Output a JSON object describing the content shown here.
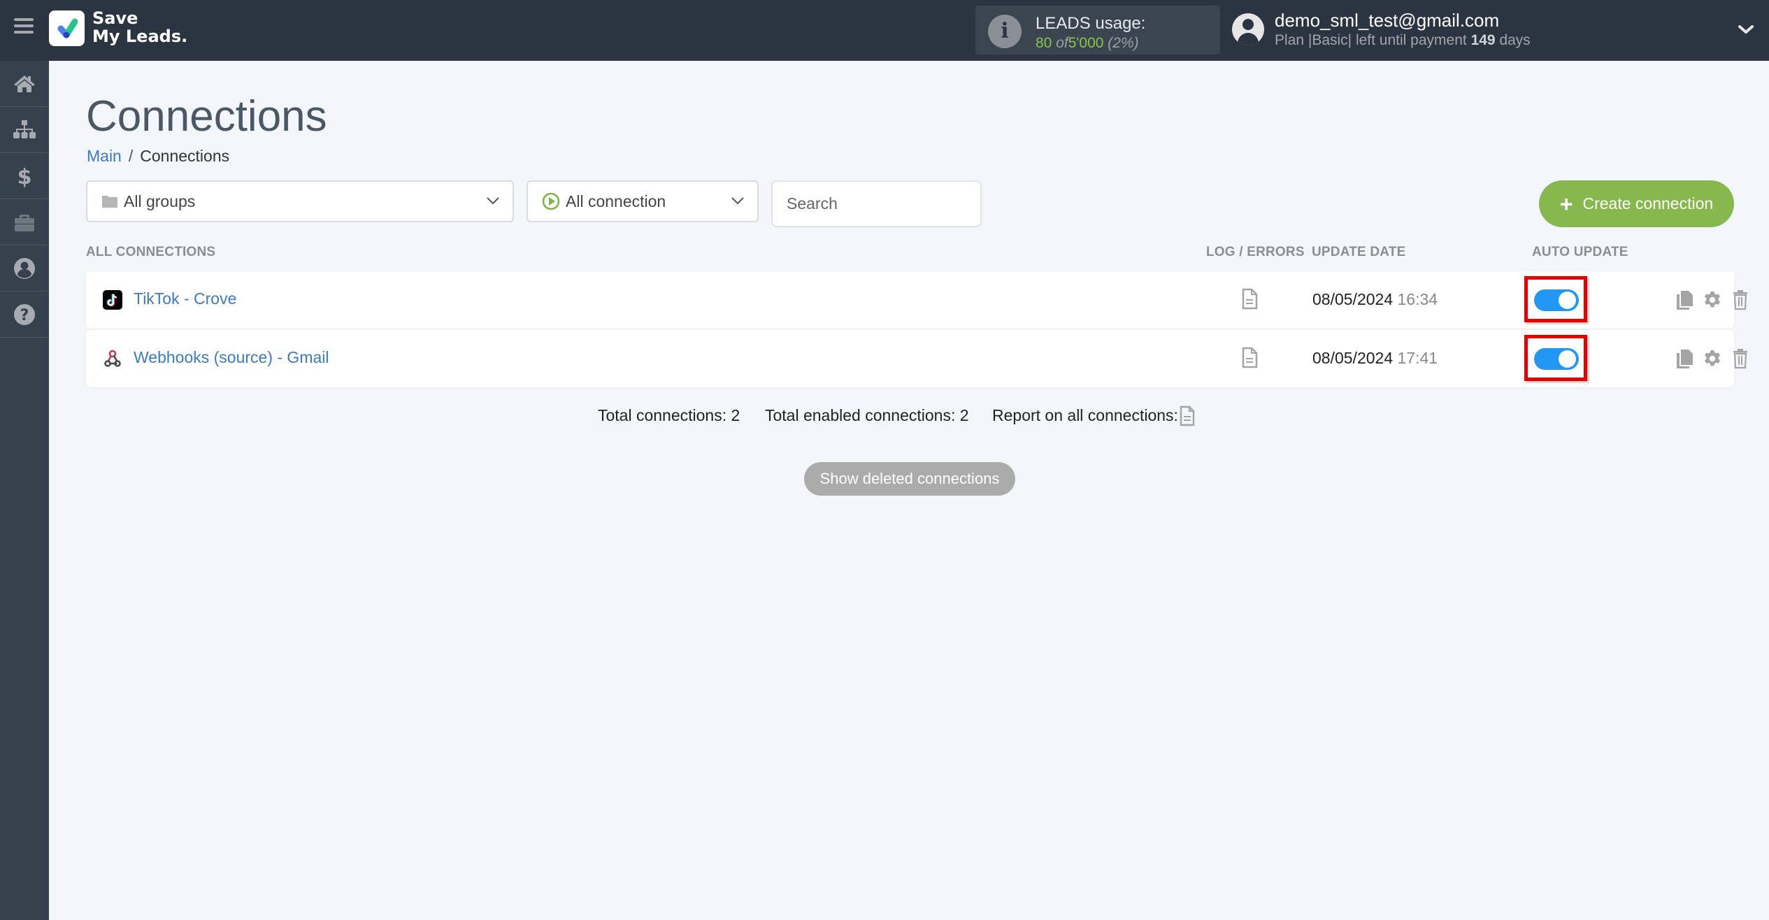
{
  "header": {
    "logo_line1": "Save",
    "logo_line2": "My Leads.",
    "usage_title": "LEADS usage:",
    "usage_used": "80",
    "usage_of": "of",
    "usage_total": "5'000",
    "usage_percent": "(2%)",
    "user_email": "demo_sml_test@gmail.com",
    "plan_prefix": "Plan |Basic| left until payment",
    "plan_days": "149",
    "plan_suffix": "days"
  },
  "sidebar": {
    "items": [
      {
        "name": "home",
        "icon": "home-icon"
      },
      {
        "name": "connections",
        "icon": "sitemap-icon"
      },
      {
        "name": "billing",
        "icon": "dollar-icon"
      },
      {
        "name": "tools",
        "icon": "briefcase-icon"
      },
      {
        "name": "account",
        "icon": "user-circle-icon"
      },
      {
        "name": "help",
        "icon": "question-circle-icon"
      }
    ]
  },
  "page": {
    "title": "Connections",
    "breadcrumb": {
      "home": "Main",
      "separator": "/",
      "current": "Connections"
    }
  },
  "filters": {
    "groups_value": "All groups",
    "connection_value": "All connection",
    "search_placeholder": "Search",
    "create_label": "Create connection"
  },
  "table": {
    "headers": {
      "all": "ALL CONNECTIONS",
      "log": "LOG / ERRORS",
      "date": "UPDATE DATE",
      "auto": "AUTO UPDATE"
    },
    "rows": [
      {
        "name": "TikTok - Crove",
        "service": "tiktok",
        "date": "08/05/2024",
        "time": "16:34",
        "auto_update": true
      },
      {
        "name": "Webhooks (source) - Gmail",
        "service": "webhooks",
        "date": "08/05/2024",
        "time": "17:41",
        "auto_update": true
      }
    ]
  },
  "summary": {
    "total": "Total connections: 2",
    "enabled": "Total enabled connections: 2",
    "report": "Report on all connections:"
  },
  "show_deleted_label": "Show deleted connections",
  "colors": {
    "header_bg": "#2b3441",
    "sidebar_bg": "#36414e",
    "page_bg": "#f3f6fa",
    "accent_green": "#86b84e",
    "link_blue": "#3b7bbf",
    "toggle_on": "#2196f3",
    "highlight_red": "#e60000"
  }
}
